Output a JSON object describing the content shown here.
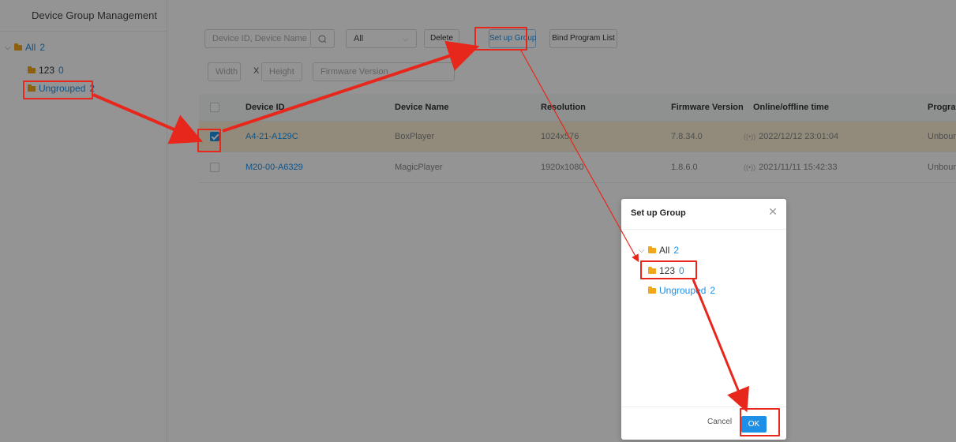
{
  "sidebar": {
    "title": "Device Group Management",
    "tree": [
      {
        "label": "All",
        "count": "2"
      },
      {
        "label": "123",
        "count": "0"
      },
      {
        "label": "Ungrouped",
        "count": "2"
      }
    ]
  },
  "toolbar": {
    "search_placeholder": "Device ID, Device Name",
    "status_select": "All",
    "delete_label": "Delete",
    "setup_group_label": "Set up Group",
    "bind_program_label": "Bind Program List",
    "width_placeholder": "Width",
    "x_label": "X",
    "height_placeholder": "Height",
    "firmware_placeholder": "Firmware Version"
  },
  "table": {
    "columns": [
      "Device ID",
      "Device Name",
      "Resolution",
      "Firmware Version",
      "Online/offline time",
      "Program Li"
    ],
    "rows": [
      {
        "device_id": "A4-21-A129C",
        "device_name": "BoxPlayer",
        "resolution": "1024x576",
        "firmware": "7.8.34.0",
        "time": "2022/12/12 23:01:04",
        "program": "Unbound",
        "checked": true
      },
      {
        "device_id": "M20-00-A6329",
        "device_name": "MagicPlayer",
        "resolution": "1920x1080",
        "firmware": "1.8.6.0",
        "time": "2021/11/11 15:42:33",
        "program": "Unbound",
        "checked": false
      }
    ]
  },
  "modal": {
    "title": "Set up Group",
    "tree": [
      {
        "label": "All",
        "count": "2"
      },
      {
        "label": "123",
        "count": "0"
      },
      {
        "label": "Ungrouped",
        "count": "2"
      }
    ],
    "cancel_label": "Cancel",
    "ok_label": "OK"
  },
  "colors": {
    "accent": "#1e8fe6",
    "folder": "#f0a81a",
    "selected_row": "#fcf0d4",
    "annotation": "#e8271c"
  },
  "icons": [
    "chevron-down-icon",
    "folder-icon",
    "search-icon",
    "chevron-down-icon",
    "close-icon",
    "checkbox-icon",
    "status-dot-icon"
  ]
}
